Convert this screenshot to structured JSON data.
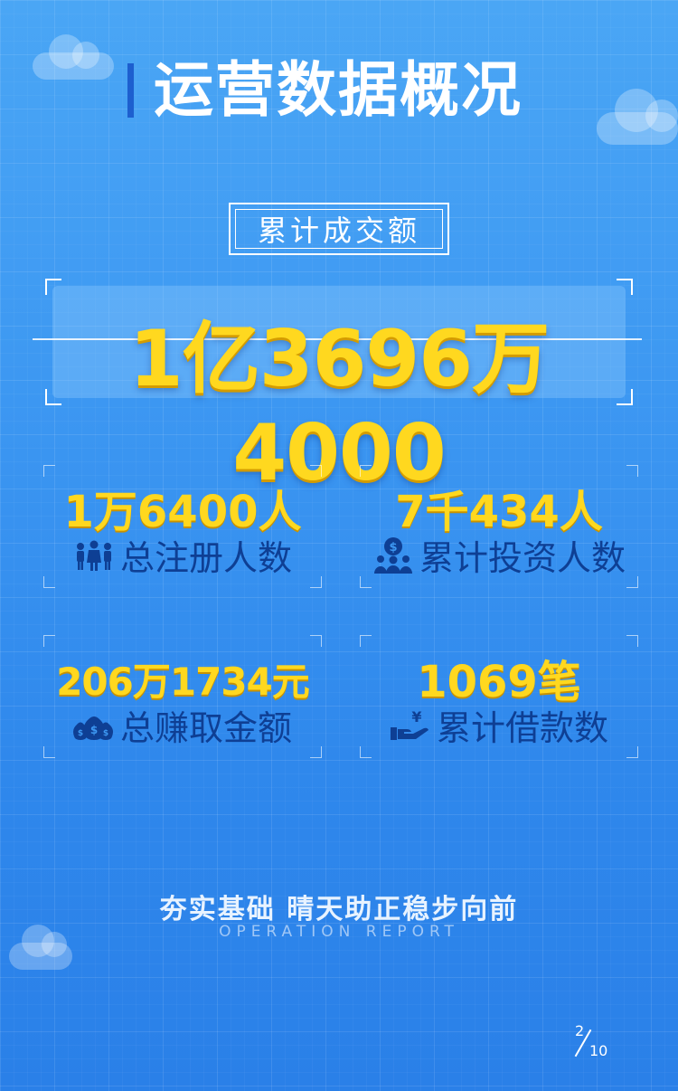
{
  "header": {
    "title": "运营数据概况"
  },
  "total": {
    "label": "累计成交额",
    "value": "1亿3696万4000"
  },
  "stats": [
    {
      "value": "1万6400人",
      "label": "总注册人数",
      "icon": "people-icon"
    },
    {
      "value": "7千434人",
      "label": "累计投资人数",
      "icon": "investor-icon"
    },
    {
      "value": "206万1734元",
      "label": "总赚取金额",
      "icon": "money-bag-icon"
    },
    {
      "value": "1069笔",
      "label": "累计借款数",
      "icon": "loan-hand-icon"
    }
  ],
  "footer": {
    "slogan": "夯实基础 晴天助正稳步向前",
    "slogan_en": "OPERATION REPORT"
  },
  "pagination": {
    "current": "2",
    "total": "10"
  },
  "colors": {
    "background": "#3d98f2",
    "highlight": "#ffd81f",
    "label": "#0e3f94"
  }
}
